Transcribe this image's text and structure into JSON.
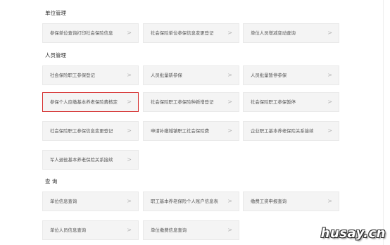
{
  "sections": {
    "unit": {
      "title": "单位管理",
      "items": [
        "参保单位查询打印社会保险信息",
        "社会保险单位参保信息变更登记",
        "单位人员增减变动查询"
      ]
    },
    "personnel": {
      "title": "人员管理",
      "items": [
        "社会保险职工参保登记",
        "人员批量新参保",
        "人员批量暂停参保",
        "参保个人应缴基本养老保险费核定",
        "社会保险职工参保险种新增登记",
        "社会保险职工参保暂停",
        "社会保险职工参保信息变更登记",
        "申请补缴城镇职工社会保险费",
        "企业职工基本养老保险关系接续",
        "军人退役基本养老保险关系接续"
      ]
    },
    "query": {
      "title": "查 询",
      "items": [
        "单位信息查询",
        "职工基本养老保险个人账户信息表",
        "缴费工资申报查询",
        "单位人员信息查询",
        "单位缴费信息查询"
      ]
    }
  },
  "chevron": ">",
  "highlight_color": "#d42b2b",
  "watermark": "husay.cn"
}
